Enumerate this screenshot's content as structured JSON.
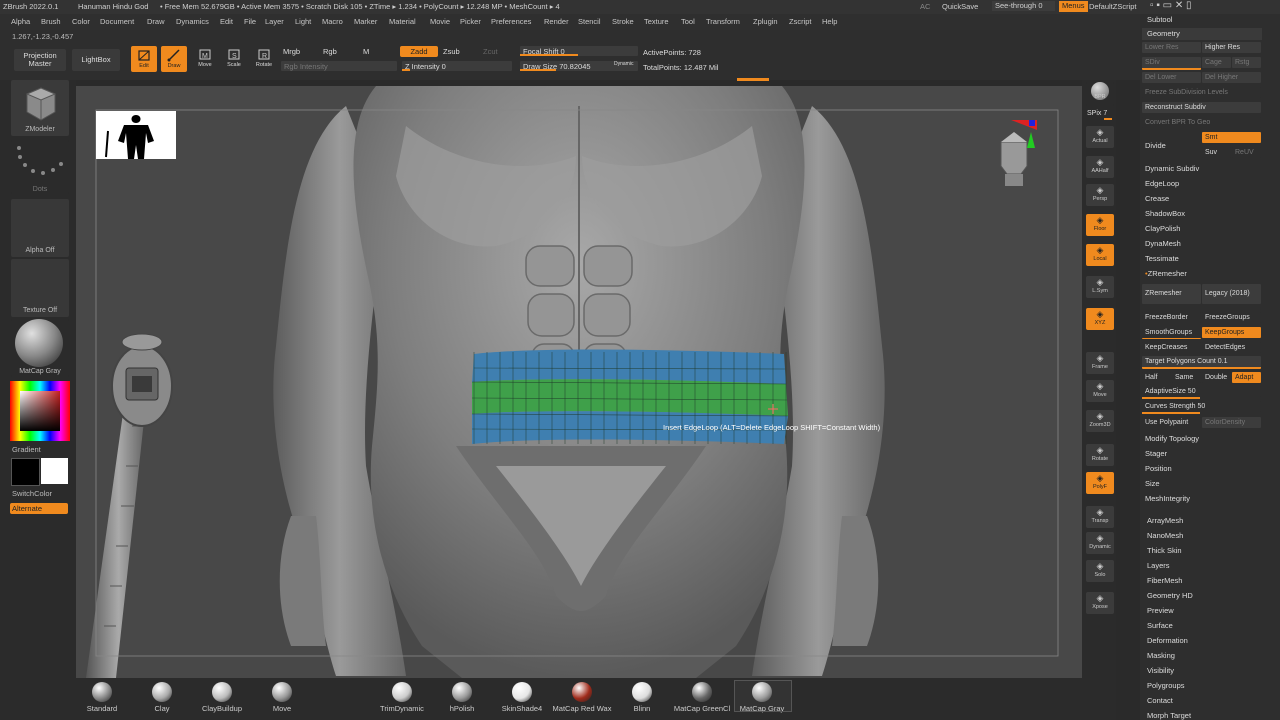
{
  "titlebar": {
    "app": "ZBrush 2022.0.1",
    "project": "Hanuman Hindu God",
    "stats": "• Free Mem 52.679GB • Active Mem 3575 • Scratch Disk 105 • ZTime ▸ 1.234 • PolyCount ▸ 12.248 MP • MeshCount ▸ 4",
    "ac": "AC",
    "quicksave": "QuickSave",
    "see_through": "See-through  0",
    "menus": "Menus",
    "script": "DefaultZScript"
  },
  "menus": [
    "Alpha",
    "Brush",
    "Color",
    "Document",
    "Draw",
    "Dynamics",
    "Edit",
    "File",
    "Layer",
    "Light",
    "Macro",
    "Marker",
    "Material",
    "Movie",
    "Picker",
    "Preferences",
    "Render",
    "Stencil",
    "Stroke",
    "Texture",
    "Tool",
    "Transform",
    "Zplugin",
    "Zscript",
    "Help"
  ],
  "coords": "1.267,-1.23,-0.457",
  "shelf": {
    "projection_master": "Projection Master",
    "lightbox": "LightBox",
    "edit": "Edit",
    "draw": "Draw",
    "move": "Move",
    "scale": "Scale",
    "rotate": "Rotate",
    "mrgb": "Mrgb",
    "rgb": "Rgb",
    "m": "M",
    "rgb_intensity": "Rgb Intensity",
    "zadd": "Zadd",
    "zsub": "Zsub",
    "zcut": "Zcut",
    "z_intensity": "Z Intensity 0",
    "focal_shift": "Focal Shift 0",
    "draw_size": "Draw Size 70.82045",
    "dynamic": "Dynamic",
    "active_points": "ActivePoints: 728",
    "total_points": "TotalPoints: 12.487 Mil"
  },
  "lefttray": {
    "brush": "ZModeler",
    "stroke": "Dots",
    "alpha": "Alpha Off",
    "texture": "Texture Off",
    "material": "MatCap Gray",
    "gradient": "Gradient",
    "switchcolor": "SwitchColor",
    "alternate": "Alternate"
  },
  "viewport": {
    "tooltip": "Insert EdgeLoop (ALT=Delete EdgeLoop SHIFT=Constant Width)"
  },
  "rightcol": {
    "bpr": "BPR",
    "spix": "SPix 7",
    "buttons": [
      "Actual",
      "AAHalf",
      "Persp",
      "Floor",
      "Local",
      "L.Sym",
      "XYZ",
      "Frame",
      "Move",
      "Zoom3D",
      "Rotate",
      "PolyF",
      "Transp",
      "Dynamic",
      "Solo",
      "Xpose"
    ]
  },
  "palette": {
    "subtool": "Subtool",
    "geometry": "Geometry",
    "lower_res": "Lower Res",
    "higher_res": "Higher Res",
    "sdiv": "SDiv",
    "cage": "Cage",
    "rstg": "Rstg",
    "del_lower": "Del Lower",
    "del_higher": "Del Higher",
    "freeze_subdiv": "Freeze SubDivision Levels",
    "reconstruct": "Reconstruct Subdiv",
    "convert_bpr": "Convert BPR To Geo",
    "divide": "Divide",
    "smt": "Smt",
    "suv": "Suv",
    "reuv": "ReUV",
    "items1": [
      "Dynamic Subdiv",
      "EdgeLoop",
      "Crease",
      "ShadowBox",
      "ClayPolish",
      "DynaMesh",
      "Tessimate"
    ],
    "zremesher_head": "ZRemesher",
    "zremesher": "ZRemesher",
    "legacy": "Legacy (2018)",
    "freezeborder": "FreezeBorder",
    "freezegroups": "FreezeGroups",
    "smoothgroups": "SmoothGroups",
    "keepgroups": "KeepGroups",
    "keepcreases": "KeepCreases",
    "detectedges": "DetectEdges",
    "target_polys": "Target Polygons Count  0.1",
    "half": "Half",
    "same": "Same",
    "double": "Double",
    "adapt": "Adapt",
    "adaptive_size": "AdaptiveSize 50",
    "curves_strength": "Curves Strength 50",
    "use_polypaint": "Use Polypaint",
    "color_density": "ColorDensity",
    "items2": [
      "Modify Topology",
      "Stager",
      "Position",
      "Size",
      "MeshIntegrity"
    ],
    "items3": [
      "ArrayMesh",
      "NanoMesh",
      "Thick Skin",
      "Layers",
      "FiberMesh",
      "Geometry HD",
      "Preview",
      "Surface",
      "Deformation",
      "Masking",
      "Visibility",
      "Polygroups",
      "Contact",
      "Morph Target"
    ]
  },
  "materials": [
    "Standard",
    "Clay",
    "ClayBuildup",
    "Move",
    "TrimDynamic",
    "hPolish",
    "SkinShade4",
    "MatCap Red Wax",
    "Blinn",
    "MatCap GreenCl",
    "MatCap Gray"
  ],
  "colors": {
    "accent": "#f08a1e",
    "bg": "#2b2b2b",
    "viewport": "#484848",
    "belt_green": "#3fa04a",
    "belt_blue": "#3f7fb0"
  }
}
